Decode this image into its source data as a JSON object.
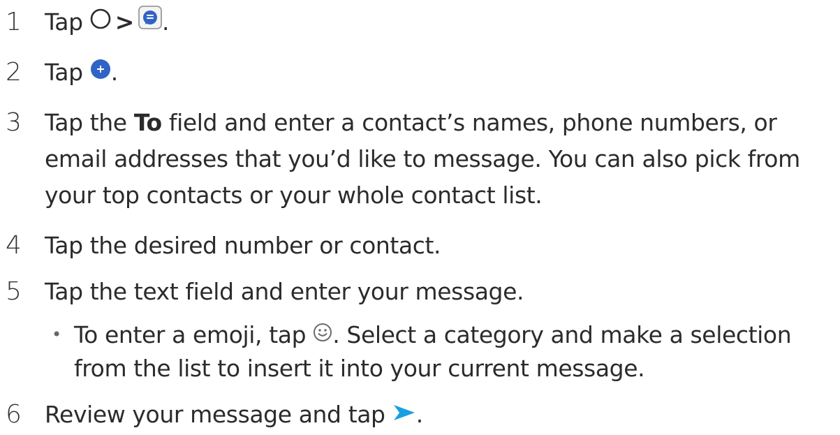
{
  "steps": [
    {
      "number": "1",
      "tap": "Tap",
      "separator": ">",
      "end": ".",
      "icons": [
        "home-circle-icon",
        "messages-app-icon"
      ]
    },
    {
      "number": "2",
      "tap": "Tap",
      "end": ".",
      "icons": [
        "add-circle-icon"
      ]
    },
    {
      "number": "3",
      "pre": "Tap the ",
      "bold": "To",
      "line1": " field and enter a contact’s names, phone numbers, or",
      "line2": "email addresses that you’d like to message. You can also pick from",
      "line3": "your top contacts or your whole contact list."
    },
    {
      "number": "4",
      "text": "Tap the desired number or contact."
    },
    {
      "number": "5",
      "text": "Tap the text field and enter your message.",
      "bullet": {
        "mark": "•",
        "pre": "To enter a emoji, tap ",
        "post": ". Select a category and make a selection",
        "line2": "from the list to insert it into your current message.",
        "icon": "smiley-icon"
      }
    },
    {
      "number": "6",
      "pre": "Review your message and tap ",
      "end": ".",
      "icons": [
        "send-icon"
      ]
    }
  ],
  "colors": {
    "text": "#2b2b2b",
    "accent_blue": "#2f63c4",
    "send_blue": "#1a9fe0",
    "icon_gray": "#9a9a9a"
  }
}
